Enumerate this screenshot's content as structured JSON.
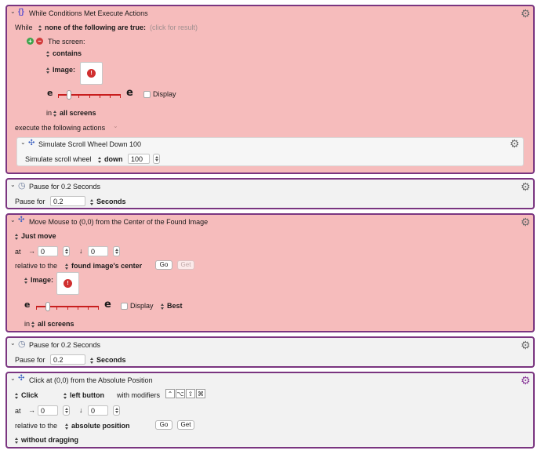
{
  "actions": [
    {
      "title": "While Conditions Met Execute Actions",
      "while_label": "While",
      "condition_mode": "none of the following are true:",
      "click_hint": "(click for result)",
      "condition": {
        "label": "The screen:",
        "mode": "contains",
        "image_label": "Image:",
        "display_label": "Display",
        "in_label": "in",
        "screens": "all screens"
      },
      "execute_label": "execute the following actions",
      "inner_action": {
        "title": "Simulate Scroll Wheel Down 100",
        "scroll_label": "Simulate scroll wheel",
        "direction": "down",
        "amount": "100"
      }
    },
    {
      "title": "Pause for 0.2 Seconds",
      "pause_label": "Pause for",
      "value": "0.2",
      "unit": "Seconds"
    },
    {
      "title": "Move Mouse to (0,0) from the Center of the Found Image",
      "mode": "Just move",
      "at_label": "at",
      "x": "0",
      "y": "0",
      "relative_label": "relative to the",
      "relative_to": "found image's center",
      "go_label": "Go",
      "get_label": "Get",
      "image_label": "Image:",
      "display_label": "Display",
      "best_label": "Best",
      "in_label": "in",
      "screens": "all screens"
    },
    {
      "title": "Pause for 0.2 Seconds",
      "pause_label": "Pause for",
      "value": "0.2",
      "unit": "Seconds"
    },
    {
      "title": "Click at (0,0) from the Absolute Position",
      "mode": "Click",
      "button": "left button",
      "modifiers_label": "with modifiers",
      "at_label": "at",
      "x": "0",
      "y": "0",
      "relative_label": "relative to the",
      "relative_to": "absolute position",
      "go_label": "Go",
      "get_label": "Get",
      "drag_mode": "without dragging"
    }
  ],
  "glyphs": {
    "arrow_right": "→",
    "arrow_down": "↓",
    "chevron": "⌄",
    "gear": "⚙",
    "plus": "+",
    "minus": "−",
    "brace": "{}",
    "e_small": "e",
    "e_large": "e",
    "clock": "◷",
    "alert": "!"
  },
  "modifier_keys": [
    "⌃",
    "⌥",
    "⇧",
    "⌘"
  ],
  "colors": {
    "pink_bg": "#f6bcbc",
    "grey_bg": "#f2f2f2",
    "border": "#7a3580",
    "slider": "#c81e1e"
  }
}
